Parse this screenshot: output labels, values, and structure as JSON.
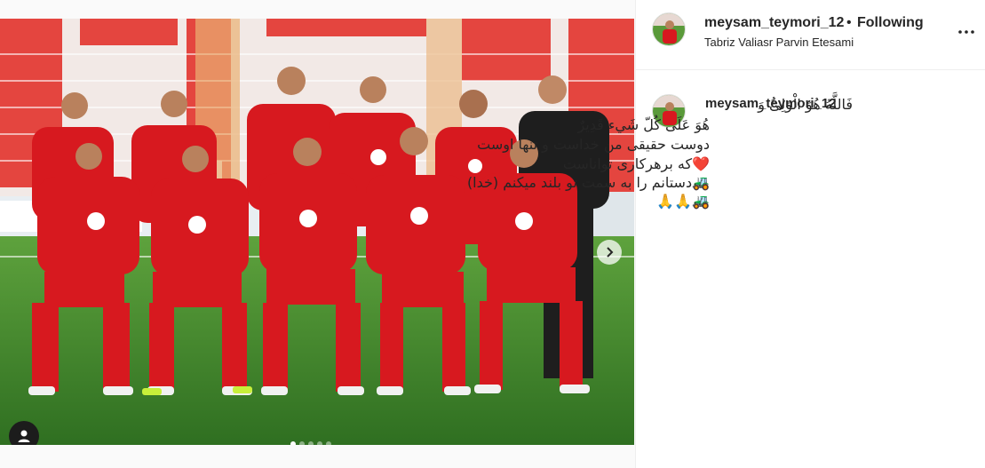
{
  "post": {
    "username": "meysam_teymori_12",
    "bullet": "•",
    "follow_label": "Following",
    "location": "Tabriz Valiasr Parvin Etesami",
    "more_icon": "more-horizontal-icon",
    "carousel": {
      "total": 5,
      "active_index": 0
    },
    "caption": {
      "username": "meysam_teymori_12",
      "line1": "فَاللَّهُ هُوَ الْوَلِیُّ وَ",
      "line2": "هُوَ عَلَى كُلّ شَيء قَدِيرٌ",
      "line3": "دوست حقیقی من خداست و تنها اوست",
      "line4": "❤️که برهرکاری تواناست",
      "line5": "🚜دستانم را به سمت تو بلند میکنم (خدا)",
      "line6": "🚜🙏🙏"
    },
    "colors": {
      "jersey_red": "#d7191f",
      "keeper_black": "#1e1e1e",
      "pitch_green": "#3f8a2c",
      "stand_red": "#e4453f"
    }
  }
}
